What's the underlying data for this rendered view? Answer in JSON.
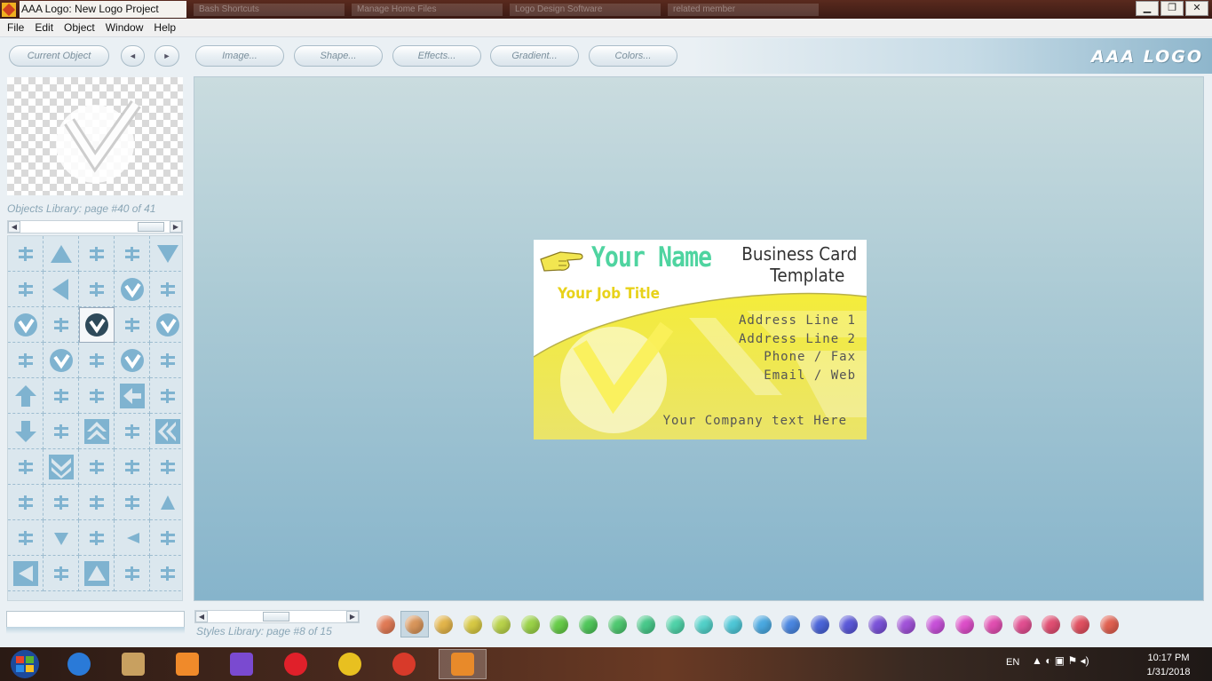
{
  "window": {
    "title": "AAA Logo: New Logo Project",
    "background_tabs": [
      "Bash Shortcuts",
      "Manage Home Files",
      "Logo Design Software",
      "related member"
    ],
    "minimize": "▁",
    "maximize": "❐",
    "close": "✕"
  },
  "menu": [
    "File",
    "Edit",
    "Object",
    "Window",
    "Help"
  ],
  "toolbar": {
    "current_object": "Current Object",
    "prev": "◄",
    "next": "►",
    "image": "Image...",
    "shape": "Shape...",
    "effects": "Effects...",
    "gradient": "Gradient...",
    "colors": "Colors...",
    "brand": "AAA LOGO"
  },
  "objects_library": {
    "label": "Objects Library: page #40 of 41",
    "selected_index": 12,
    "icons": [
      "bracket-icon",
      "triangle-icon",
      "bird-icon",
      "corner-icon",
      "down-triangle-icon",
      "dots-icon",
      "left-triangle-icon",
      "equals-icon",
      "circle-up-icon",
      "frame-icon",
      "circle-left-icon",
      "connector-icon",
      "circle-check-icon",
      "link-icon",
      "circle-y-icon",
      "plusminus-icon",
      "circle-split-icon",
      "align-icon",
      "circle-fork-icon",
      "equals-arrow-icon",
      "arrow-up-icon",
      "animal-icon",
      "cross-bar-icon",
      "arrow-left-box-icon",
      "h-icon",
      "arrow-down-icon",
      "hook-icon",
      "double-up-icon",
      "e-icon",
      "double-left-icon",
      "pi-icon",
      "double-down-box-icon",
      "pi-icon",
      "arrow-up-thin-icon",
      "t-icon",
      "return-icon",
      "step-icon",
      "arrow-down-thin-icon",
      "grid-icon",
      "triangle-small-icon",
      "plug-icon",
      "down-small-icon",
      "corner-l-icon",
      "left-small-icon",
      "info-icon",
      "play-left-box-icon",
      "corner-r-icon",
      "up-box-icon",
      "person-icon",
      "step-r-icon"
    ]
  },
  "card": {
    "name": "Your Name",
    "title_line1": "Business Card",
    "title_line2": "Template",
    "job_title": "Your Job Title",
    "address1": "Address Line 1",
    "address2": "Address Line 2",
    "phone": "Phone / Fax",
    "email": "Email / Web",
    "company": "Your Company text Here"
  },
  "styles_library": {
    "label": "Styles Library: page #8 of 15",
    "selected_index": 1,
    "colors": [
      "#e07a55",
      "#d8955a",
      "#e2b44a",
      "#d6c843",
      "#b8d24a",
      "#9ad248",
      "#66cc48",
      "#4fc65a",
      "#4ec870",
      "#48c88a",
      "#4fd2a8",
      "#52d0c8",
      "#4ec6d6",
      "#4aa8e0",
      "#4a86e0",
      "#4a64d8",
      "#5a58d8",
      "#7a52d8",
      "#a052d8",
      "#c650d8",
      "#dc4ec8",
      "#e04eb0",
      "#e04e90",
      "#e04e72",
      "#e05060",
      "#e06050"
    ]
  },
  "taskbar": {
    "apps": [
      "ie",
      "explorer",
      "media-player",
      "visual-studio",
      "opera",
      "chrome",
      "settings",
      "aaa-logo"
    ],
    "active_index": 7,
    "language": "EN",
    "tray_icons": "▲ ◐ ▣ ⚑ ◂)",
    "time": "10:17 PM",
    "date": "1/31/2018"
  }
}
